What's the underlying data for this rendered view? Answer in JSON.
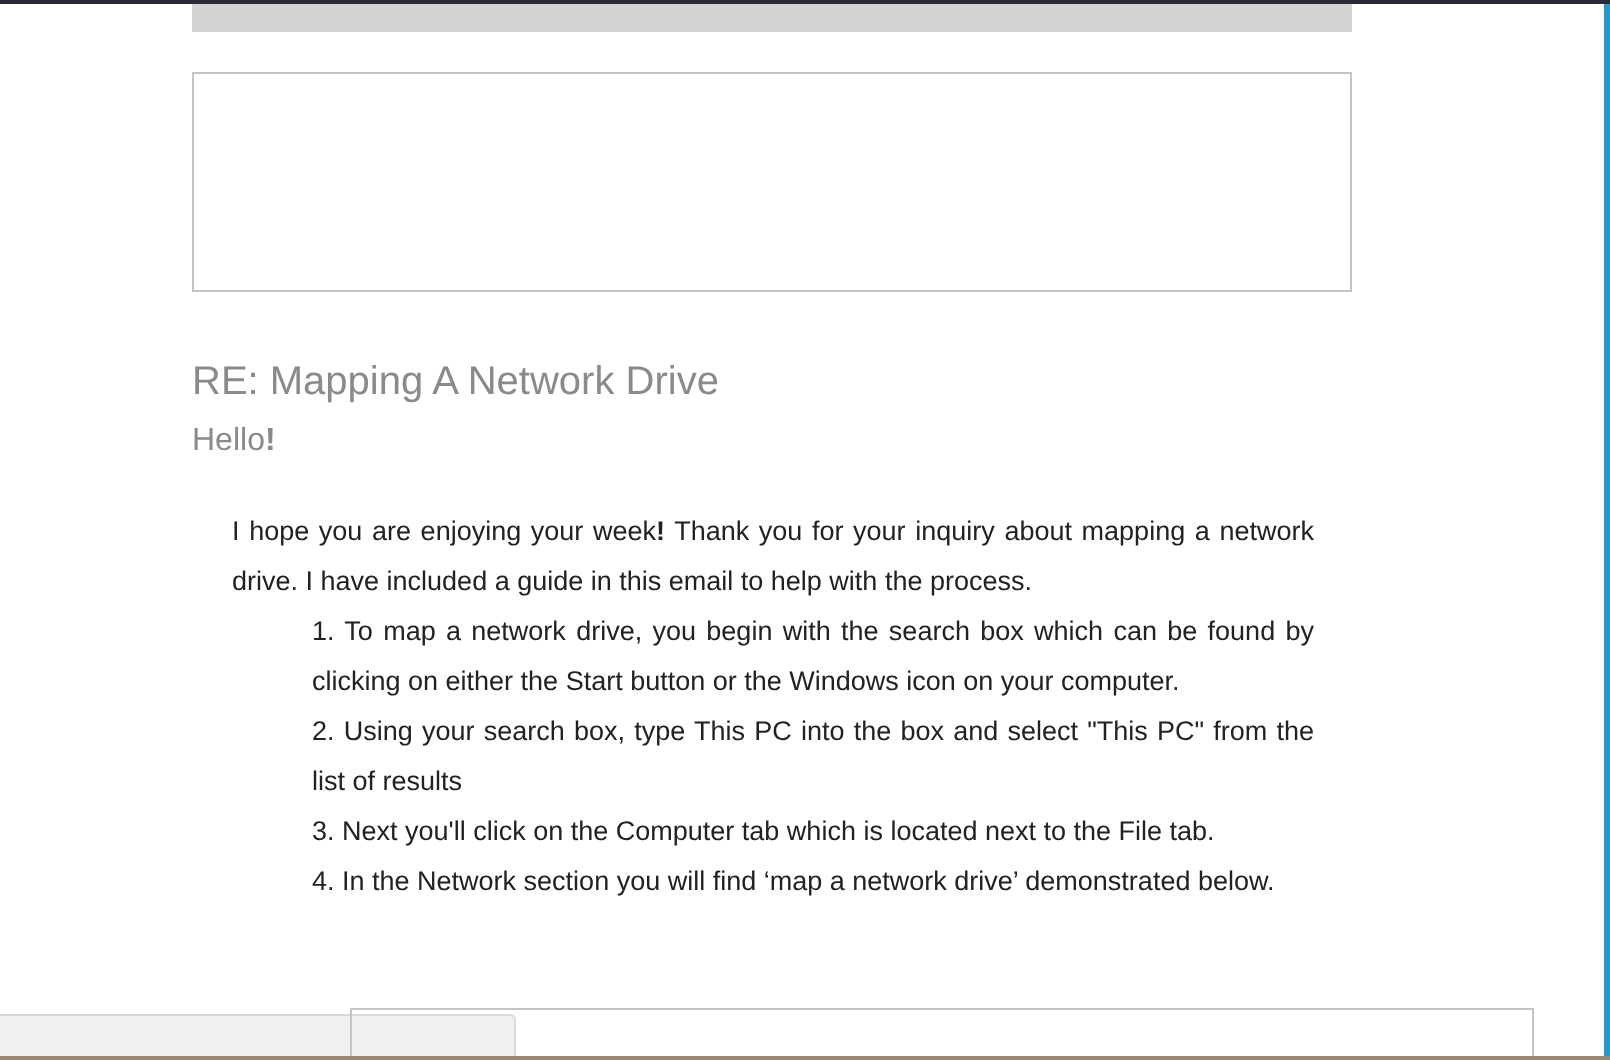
{
  "email": {
    "subject": "RE: Mapping A Network Drive",
    "greeting": "Hello**!**",
    "intro": "I hope you are enjoying your week**!** Thank you for your inquiry about mapping a network drive. I have included a guide in this email to help with the process.",
    "steps": [
      "1. To map a network drive, you begin with the search box which can be found by clicking on either the Start button or the Windows icon on your computer.",
      "2. Using your search box, type This PC into the box and select \"This PC\" from the list of results",
      "3. Next you'll click on the Computer tab which is located next to the File tab.",
      "4. In the Network section you will find ‘map a network drive’ demonstrated below."
    ]
  }
}
